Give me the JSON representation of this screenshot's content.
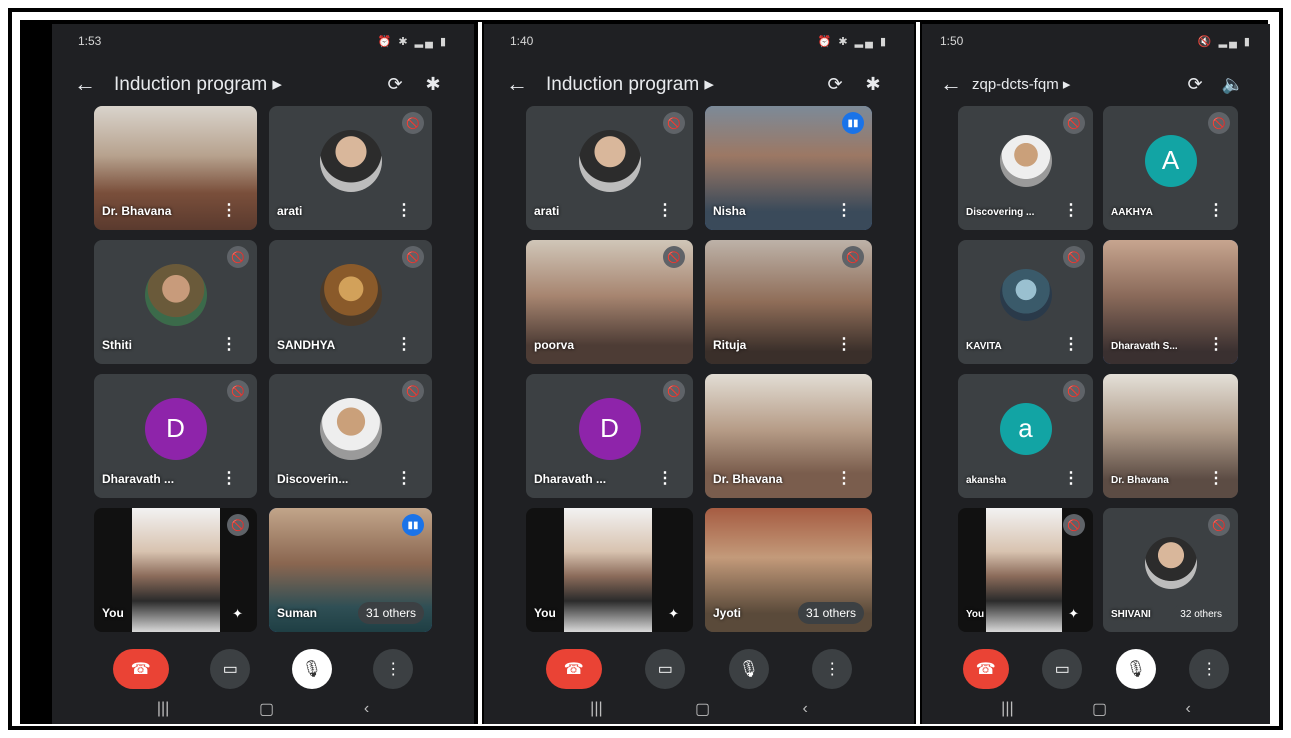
{
  "phones": [
    {
      "status_time": "1:53",
      "title": "Induction program",
      "tiles": [
        {
          "name": "Dr. Bhavana"
        },
        {
          "name": "arati"
        },
        {
          "name": "Sthiti"
        },
        {
          "name": "SANDHYA"
        },
        {
          "name": "Dharavath ...",
          "initial": "D"
        },
        {
          "name": "Discoverin..."
        },
        {
          "name": "You"
        },
        {
          "name": "Suman",
          "others": "31 others"
        }
      ]
    },
    {
      "status_time": "1:40",
      "title": "Induction program",
      "tiles": [
        {
          "name": "arati"
        },
        {
          "name": "Nisha"
        },
        {
          "name": "poorva"
        },
        {
          "name": "Rituja"
        },
        {
          "name": "Dharavath ...",
          "initial": "D"
        },
        {
          "name": "Dr. Bhavana"
        },
        {
          "name": "You"
        },
        {
          "name": "Jyoti",
          "others": "31 others"
        }
      ]
    },
    {
      "status_time": "1:50",
      "title": "zqp-dcts-fqm",
      "tiles": [
        {
          "name": "Discovering ..."
        },
        {
          "name": "AAKHYA",
          "initial": "A"
        },
        {
          "name": "KAVITA"
        },
        {
          "name": "Dharavath S..."
        },
        {
          "name": "akansha",
          "initial": "a"
        },
        {
          "name": "Dr. Bhavana"
        },
        {
          "name": "You"
        },
        {
          "name": "SHIVANI",
          "others": "32 others"
        }
      ]
    }
  ],
  "icons": {
    "back": "back-arrow-icon",
    "camera_switch": "camera-switch-icon",
    "bluetooth": "bluetooth-icon",
    "speaker": "speaker-icon",
    "hangup": "hangup-icon",
    "camera": "camera-icon",
    "mic": "mic-icon",
    "more": "more-vert-icon"
  },
  "colors": {
    "background": "#1f2023",
    "tile": "#3c4043",
    "hangup": "#ea4335",
    "active_border": "#2f6fd6",
    "avatar_purple": "#8e24aa",
    "avatar_teal": "#12a4a4"
  }
}
